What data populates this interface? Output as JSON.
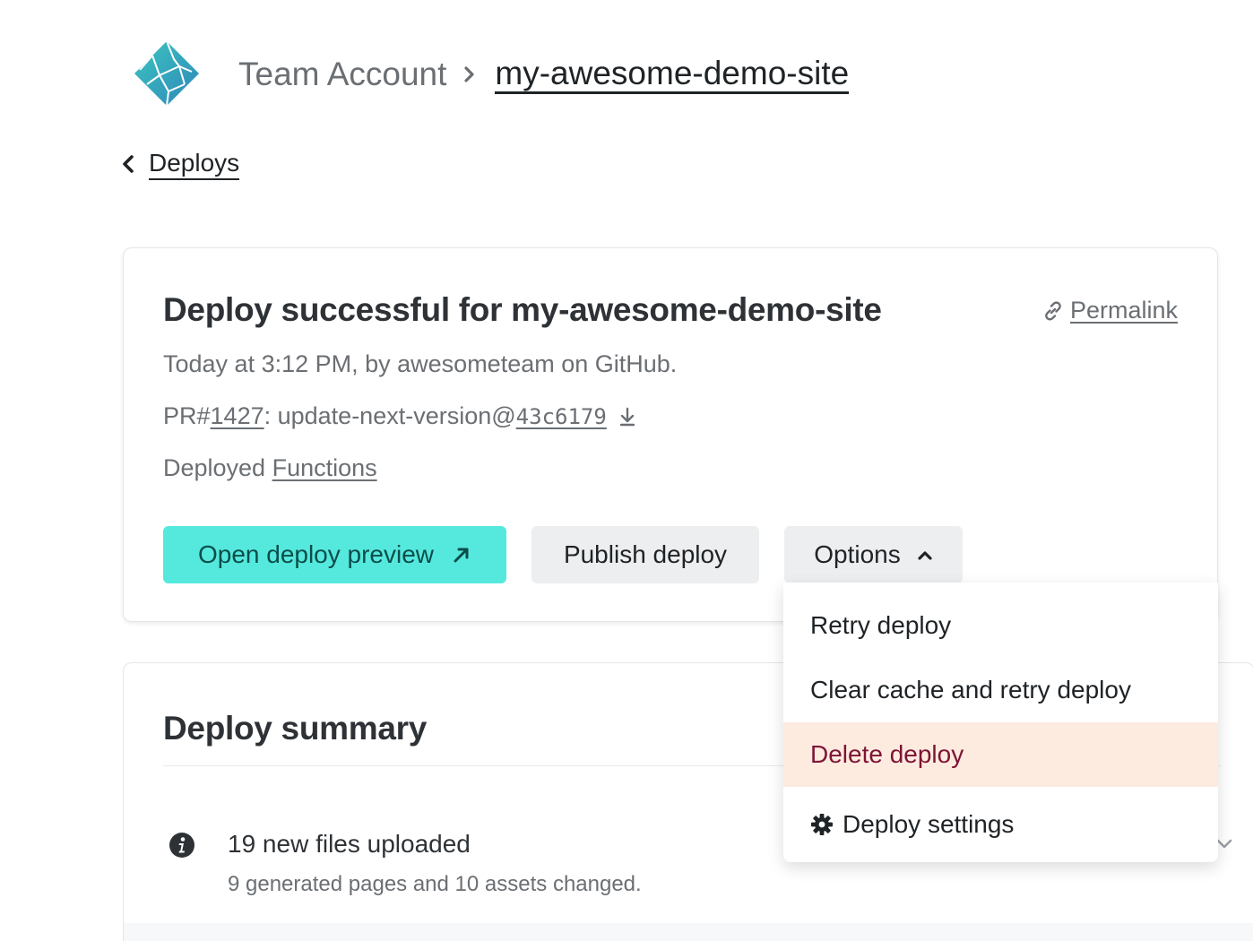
{
  "header": {
    "logo_icon": "netlify-logo-icon",
    "breadcrumb": {
      "team": "Team Account",
      "separator_icon": "chevron-right-icon",
      "site": "my-awesome-demo-site"
    },
    "back_link": {
      "label": "Deploys",
      "icon": "chevron-left-icon"
    }
  },
  "deploy_card": {
    "title": "Deploy successful for my-awesome-demo-site",
    "permalink_label": "Permalink",
    "meta_line": "Today at 3:12 PM, by awesometeam on GitHub.",
    "pr": {
      "prefix": "PR#",
      "number": "1427",
      "branch_text": ": update-next-version@",
      "commit": "43c6179"
    },
    "functions": {
      "prefix": "Deployed ",
      "link": "Functions"
    },
    "buttons": {
      "preview": "Open deploy preview",
      "publish": "Publish deploy",
      "options": "Options"
    }
  },
  "options_menu": {
    "items": [
      {
        "label": "Retry deploy"
      },
      {
        "label": "Clear cache and retry deploy"
      },
      {
        "label": "Delete deploy",
        "style": "danger"
      },
      {
        "label": "Deploy settings",
        "icon": "gear-icon"
      }
    ]
  },
  "summary": {
    "title": "Deploy summary",
    "items": [
      {
        "icon": "info-icon",
        "title": "19 new files uploaded",
        "subtitle": "9 generated pages and 10 assets changed."
      }
    ]
  },
  "colors": {
    "accent": "#55e9de",
    "danger_bg": "#fdebdf",
    "danger_text": "#7d1435"
  }
}
